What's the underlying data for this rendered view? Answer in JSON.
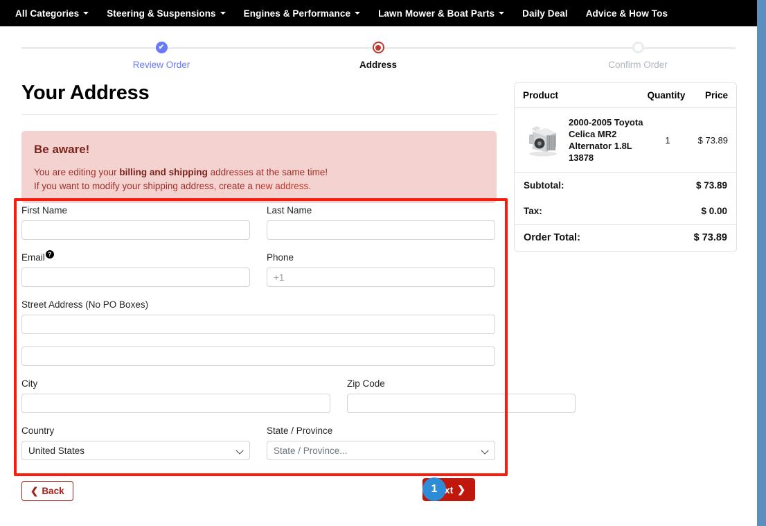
{
  "nav": {
    "items": [
      {
        "label": "All Categories",
        "caret": true
      },
      {
        "label": "Steering & Suspensions",
        "caret": true
      },
      {
        "label": "Engines & Performance",
        "caret": true
      },
      {
        "label": "Lawn Mower & Boat Parts",
        "caret": true
      },
      {
        "label": "Daily Deal",
        "caret": false
      },
      {
        "label": "Advice & How Tos",
        "caret": false
      }
    ]
  },
  "stepper": {
    "steps": [
      {
        "label": "Review Order",
        "state": "done"
      },
      {
        "label": "Address",
        "state": "active"
      },
      {
        "label": "Confirm Order",
        "state": "todo"
      }
    ],
    "check_glyph": "✔"
  },
  "page": {
    "title": "Your Address"
  },
  "alert": {
    "title": "Be aware!",
    "line1_pre": "You are editing your ",
    "line1_bold": "billing and shipping",
    "line1_post": " addresses at the same time!",
    "line2_pre": "If you want to modify your shipping address, create a ",
    "line2_link": "new address",
    "line2_post": "."
  },
  "form": {
    "first_name": {
      "label": "First Name",
      "value": "",
      "placeholder": ""
    },
    "last_name": {
      "label": "Last Name",
      "value": "",
      "placeholder": ""
    },
    "email": {
      "label": "Email",
      "value": "",
      "placeholder": "",
      "help_glyph": "?"
    },
    "phone": {
      "label": "Phone",
      "value": "",
      "placeholder": "+1"
    },
    "street": {
      "label": "Street Address (No PO Boxes)",
      "value": "",
      "placeholder": ""
    },
    "street2": {
      "label": "",
      "value": "",
      "placeholder": ""
    },
    "city": {
      "label": "City",
      "value": "",
      "placeholder": ""
    },
    "zip": {
      "label": "Zip Code",
      "value": "",
      "placeholder": ""
    },
    "country": {
      "label": "Country",
      "value": "United States"
    },
    "state": {
      "label": "State / Province",
      "value": "State / Province..."
    }
  },
  "buttons": {
    "back": "Back",
    "back_glyph": "❮",
    "next": "Next",
    "next_glyph": "❯",
    "step_badge": "1"
  },
  "summary": {
    "columns": {
      "product": "Product",
      "quantity": "Quantity",
      "price": "Price"
    },
    "items": [
      {
        "name": "2000-2005 Toyota Celica MR2 Alternator 1.8L 13878",
        "quantity": "1",
        "price": "$ 73.89",
        "thumb": "alternator-photo"
      }
    ],
    "rows": [
      {
        "label": "Subtotal:",
        "value": "$ 73.89",
        "emphasis": false
      },
      {
        "label": "Tax:",
        "value": "$ 0.00",
        "emphasis": false
      },
      {
        "label": "Order Total:",
        "value": "$ 73.89",
        "emphasis": true
      }
    ]
  },
  "colors": {
    "nav_bg": "#000000",
    "alert_bg": "#f4d2d0",
    "alert_text": "#9b3028",
    "highlight_border": "#f91b0d",
    "next_button": "#c0170c",
    "badge_blue": "#2e8bd6",
    "step_done": "#6979f8",
    "step_active": "#c0392b",
    "scrollbar": "#5b8fc0"
  }
}
